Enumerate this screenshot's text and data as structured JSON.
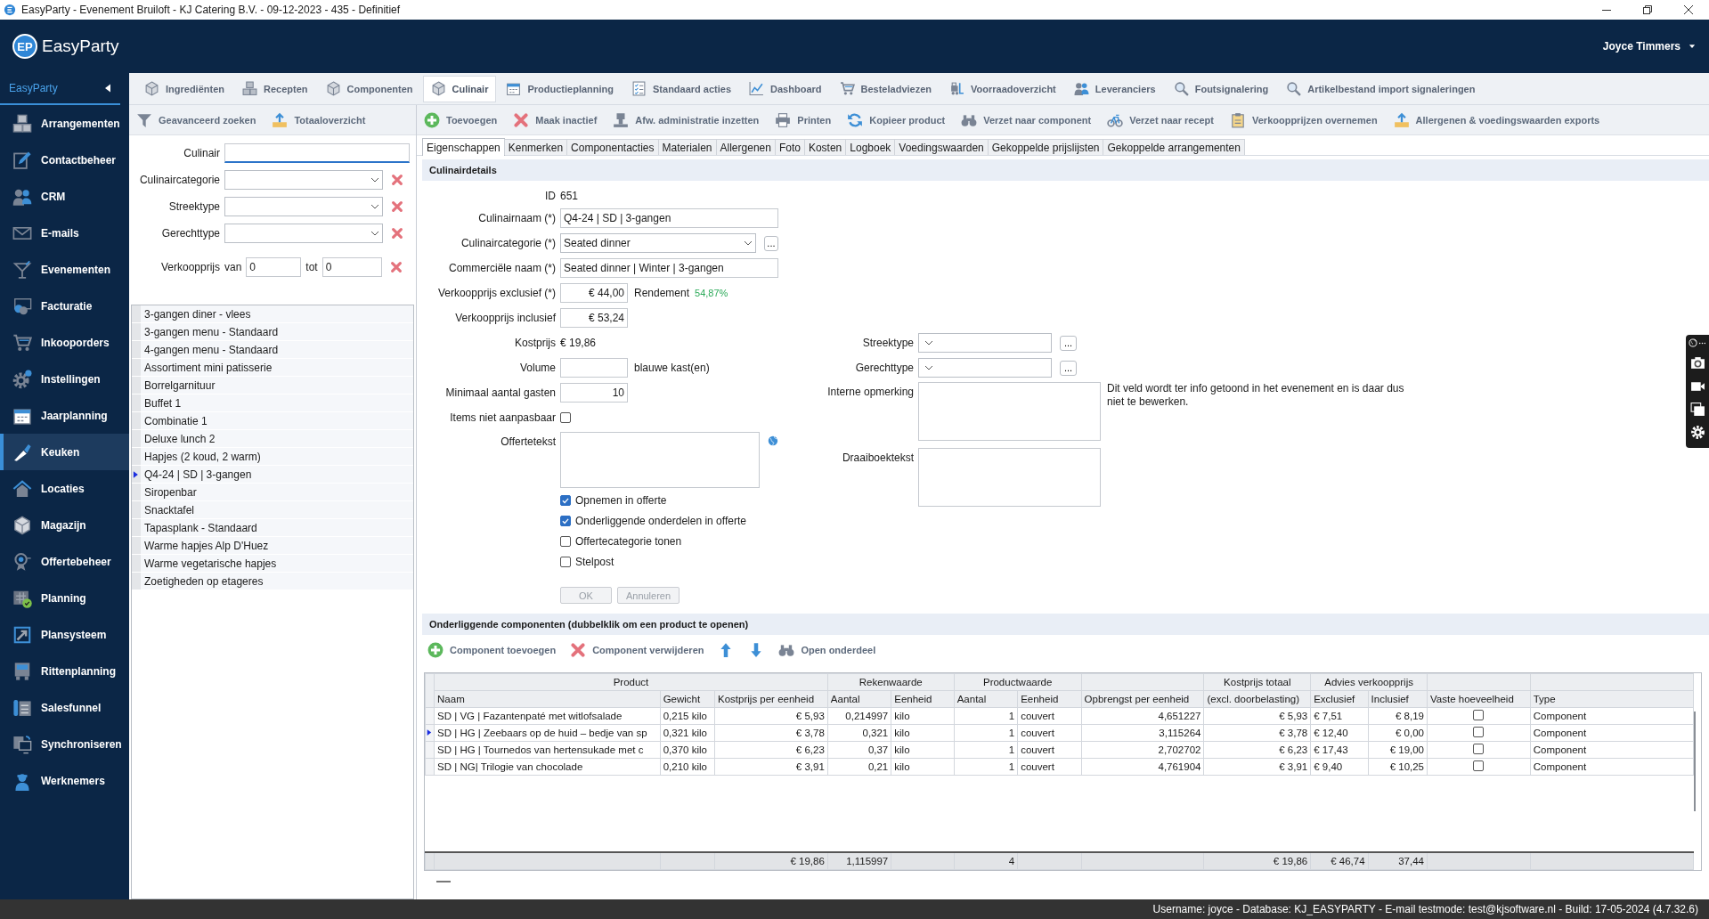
{
  "window": {
    "title": "EasyParty - Evenement Bruiloft - KJ Catering B.V. - 09-12-2023 - 435 - Definitief"
  },
  "header": {
    "logo_badge": "EP",
    "logo_text": "EasyParty",
    "user": "Joyce Timmers"
  },
  "sidebar": {
    "title": "EasyParty",
    "items": [
      {
        "label": "Arrangementen",
        "selected": false
      },
      {
        "label": "Contactbeheer",
        "selected": false
      },
      {
        "label": "CRM",
        "selected": false
      },
      {
        "label": "E-mails",
        "selected": false
      },
      {
        "label": "Evenementen",
        "selected": false
      },
      {
        "label": "Facturatie",
        "selected": false
      },
      {
        "label": "Inkooporders",
        "selected": false
      },
      {
        "label": "Instellingen",
        "selected": false
      },
      {
        "label": "Jaarplanning",
        "selected": false
      },
      {
        "label": "Keuken",
        "selected": true
      },
      {
        "label": "Locaties",
        "selected": false
      },
      {
        "label": "Magazijn",
        "selected": false
      },
      {
        "label": "Offertebeheer",
        "selected": false
      },
      {
        "label": "Planning",
        "selected": false
      },
      {
        "label": "Plansysteem",
        "selected": false
      },
      {
        "label": "Rittenplanning",
        "selected": false
      },
      {
        "label": "Salesfunnel",
        "selected": false
      },
      {
        "label": "Synchroniseren",
        "selected": false
      },
      {
        "label": "Werknemers",
        "selected": false
      }
    ]
  },
  "module_tabs": [
    {
      "label": "Ingrediënten",
      "selected": false
    },
    {
      "label": "Recepten",
      "selected": false
    },
    {
      "label": "Componenten",
      "selected": false
    },
    {
      "label": "Culinair",
      "selected": true
    },
    {
      "label": "Productieplanning",
      "selected": false
    },
    {
      "label": "Standaard acties",
      "selected": false
    },
    {
      "label": "Dashboard",
      "selected": false
    },
    {
      "label": "Besteladviezen",
      "selected": false
    },
    {
      "label": "Voorraadoverzicht",
      "selected": false
    },
    {
      "label": "Leveranciers",
      "selected": false
    },
    {
      "label": "Foutsignalering",
      "selected": false
    },
    {
      "label": "Artikelbestand import signaleringen",
      "selected": false
    }
  ],
  "search_toolbar": [
    "Geavanceerd zoeken",
    "Totaaloverzicht"
  ],
  "action_toolbar": [
    "Toevoegen",
    "Maak inactief",
    "Afw. administratie inzetten",
    "Printen",
    "Kopieer product",
    "Verzet naar component",
    "Verzet naar recept",
    "Verkoopprijzen overnemen",
    "Allergenen & voedingswaarden exports"
  ],
  "filter": {
    "fields": [
      {
        "kind": "text",
        "label": "Culinair",
        "focused": true
      },
      {
        "kind": "combo",
        "label": "Culinaircategorie"
      },
      {
        "kind": "combo",
        "label": "Streektype"
      },
      {
        "kind": "combo",
        "label": "Gerechttype"
      },
      {
        "kind": "range",
        "label": "Verkoopprijs",
        "from_label": "van",
        "from": "0",
        "to_label": "tot",
        "to": "0"
      }
    ]
  },
  "list": [
    {
      "label": "3-gangen diner - vlees",
      "selected": false
    },
    {
      "label": "3-gangen menu - Standaard",
      "selected": false
    },
    {
      "label": "4-gangen menu - Standaard",
      "selected": false
    },
    {
      "label": "Assortiment mini patisserie",
      "selected": false
    },
    {
      "label": "Borrelgarnituur",
      "selected": false
    },
    {
      "label": "Buffet 1",
      "selected": false
    },
    {
      "label": "Combinatie 1",
      "selected": false
    },
    {
      "label": "Deluxe lunch 2",
      "selected": false
    },
    {
      "label": "Hapjes (2 koud, 2 warm)",
      "selected": false
    },
    {
      "label": "Q4-24 | SD | 3-gangen",
      "selected": true
    },
    {
      "label": "Siropenbar",
      "selected": false
    },
    {
      "label": "Snacktafel",
      "selected": false
    },
    {
      "label": "Tapasplank - Standaard",
      "selected": false
    },
    {
      "label": "Warme hapjes Alp D'Huez",
      "selected": false
    },
    {
      "label": "Warme vegetarische hapjes",
      "selected": false
    },
    {
      "label": "Zoetigheden op etageres",
      "selected": false
    }
  ],
  "detail_tabs": [
    {
      "label": "Eigenschappen",
      "selected": true
    },
    {
      "label": "Kenmerken",
      "selected": false
    },
    {
      "label": "Componentacties",
      "selected": false
    },
    {
      "label": "Materialen",
      "selected": false
    },
    {
      "label": "Allergenen",
      "selected": false
    },
    {
      "label": "Foto",
      "selected": false
    },
    {
      "label": "Kosten",
      "selected": false
    },
    {
      "label": "Logboek",
      "selected": false
    },
    {
      "label": "Voedingswaarden",
      "selected": false
    },
    {
      "label": "Gekoppelde prijslijsten",
      "selected": false
    },
    {
      "label": "Gekoppelde arrangementen",
      "selected": false
    }
  ],
  "details": {
    "title": "Culinairdetails",
    "fields": [
      {
        "kind": "static",
        "label": "ID",
        "value": "651"
      },
      {
        "kind": "text",
        "label": "Culinairnaam (*)",
        "value": "Q4-24 | SD | 3-gangen"
      },
      {
        "kind": "combo",
        "label": "Culinaircategorie (*)",
        "value": "Seated dinner",
        "more": "..."
      },
      {
        "kind": "text",
        "label": "Commerciële naam (*)",
        "value": "Seated dinner | Winter | 3-gangen"
      },
      {
        "kind": "amount",
        "label": "Verkoopprijs exclusief (*)",
        "value": "€ 44,00",
        "extra": {
          "label": "Rendement",
          "value": "54,87%"
        }
      },
      {
        "kind": "amount",
        "label": "Verkoopprijs inclusief",
        "value": "€ 53,24"
      },
      {
        "kind": "static",
        "label": "Kostprijs",
        "value": "€ 19,86"
      },
      {
        "kind": "amount",
        "label": "Volume",
        "suffix": "blauwe kast(en)"
      },
      {
        "kind": "amount",
        "label": "Minimaal aantal gasten",
        "value": "10"
      },
      {
        "kind": "check",
        "label": "Items niet aanpasbaar",
        "checked": false
      },
      {
        "kind": "memo",
        "label": "Offertetekst",
        "translatable": true
      }
    ],
    "side_fields": [
      {
        "kind": "combo",
        "label": "Streektype",
        "more": "..."
      },
      {
        "kind": "combo",
        "label": "Gerechttype",
        "more": "..."
      },
      {
        "kind": "memo",
        "label": "Interne opmerking",
        "note": "Dit veld wordt ter info getoond in het evenement en is daar dus niet te bewerken."
      },
      {
        "kind": "memo",
        "label": "Draaiboektekst"
      }
    ],
    "options": [
      {
        "label": "Opnemen in offerte",
        "checked": true
      },
      {
        "label": "Onderliggende onderdelen in offerte",
        "checked": true
      },
      {
        "label": "Offertecategorie tonen",
        "checked": false
      },
      {
        "label": "Stelpost",
        "checked": false
      }
    ],
    "buttons": [
      {
        "label": "OK",
        "disabled": true
      },
      {
        "label": "Annuleren",
        "disabled": true
      }
    ]
  },
  "components": {
    "title": "Onderliggende componenten (dubbelklik om een product te openen)",
    "toolbar": [
      {
        "kind": "add",
        "label": "Component toevoegen"
      },
      {
        "kind": "delete",
        "label": "Component verwijderen"
      },
      {
        "kind": "up"
      },
      {
        "kind": "down"
      },
      {
        "kind": "open",
        "label": "Open onderdeel"
      }
    ],
    "column_groups": [
      {
        "kind": "group",
        "label": "Product",
        "colspan": 3
      },
      {
        "kind": "group",
        "label": "Rekenwaarde",
        "colspan": 2
      },
      {
        "kind": "group",
        "label": "Productwaarde",
        "colspan": 2
      },
      {
        "kind": "blank"
      },
      {
        "kind": "group",
        "label": "Kostprijs totaal"
      },
      {
        "kind": "group",
        "label": "Advies verkoopprijs",
        "colspan": 2
      },
      {
        "kind": "blank"
      },
      {
        "kind": "blank"
      }
    ],
    "columns": [
      {
        "label": "Naam",
        "kind": "text"
      },
      {
        "label": "Gewicht",
        "kind": "text"
      },
      {
        "label": "Kostprijs per eenheid",
        "kind": "number",
        "total": "€ 19,86"
      },
      {
        "label": "Aantal",
        "kind": "number",
        "total": "1,115997"
      },
      {
        "label": "Eenheid",
        "kind": "text"
      },
      {
        "label": "Aantal",
        "kind": "number",
        "total": "4"
      },
      {
        "label": "Eenheid",
        "kind": "text"
      },
      {
        "label": "Opbrengst per eenheid",
        "kind": "number"
      },
      {
        "label": "(excl. doorbelasting)",
        "kind": "number",
        "total": "€ 19,86"
      },
      {
        "label": "Exclusief",
        "kind": "text",
        "total": "€ 46,74"
      },
      {
        "label": "Inclusief",
        "kind": "number",
        "total": "37,44"
      },
      {
        "label": "Vaste hoeveelheid",
        "kind": "check"
      },
      {
        "label": "Type",
        "kind": "text"
      }
    ],
    "rows": [
      {
        "selected": false,
        "fixed_quantity": false,
        "cells": [
          "SD | VG | Fazantenpaté met witlofsalade",
          "0,215 kilo",
          "€ 5,93",
          "0,214997",
          "kilo",
          "1",
          "couvert",
          "4,651227",
          "€ 5,93",
          "€ 7,51",
          "€ 8,19",
          "Component"
        ]
      },
      {
        "selected": true,
        "fixed_quantity": false,
        "cells": [
          "SD | HG | Zeebaars op de huid – bedje van sp",
          "0,321 kilo",
          "€ 3,78",
          "0,321",
          "kilo",
          "1",
          "couvert",
          "3,115264",
          "€ 3,78",
          "€ 12,40",
          "€ 0,00",
          "Component"
        ]
      },
      {
        "selected": false,
        "fixed_quantity": false,
        "cells": [
          "SD | HG | Tournedos van hertensukade met c",
          "0,370 kilo",
          "€ 6,23",
          "0,37",
          "kilo",
          "1",
          "couvert",
          "2,702702",
          "€ 6,23",
          "€ 17,43",
          "€ 19,00",
          "Component"
        ]
      },
      {
        "selected": false,
        "fixed_quantity": false,
        "cells": [
          "SD | NG| Trilogie van chocolade",
          "0,210 kilo",
          "€ 3,91",
          "0,21",
          "kilo",
          "1",
          "couvert",
          "4,761904",
          "€ 3,91",
          "€ 9,40",
          "€ 10,25",
          "Component"
        ]
      }
    ]
  },
  "status_bar": "Username: joyce - Database: KJ_EASYPARTY - E-mail testmode: test@kjsoftware.nl - Build: 17-05-2024 (4.7.32.6)"
}
